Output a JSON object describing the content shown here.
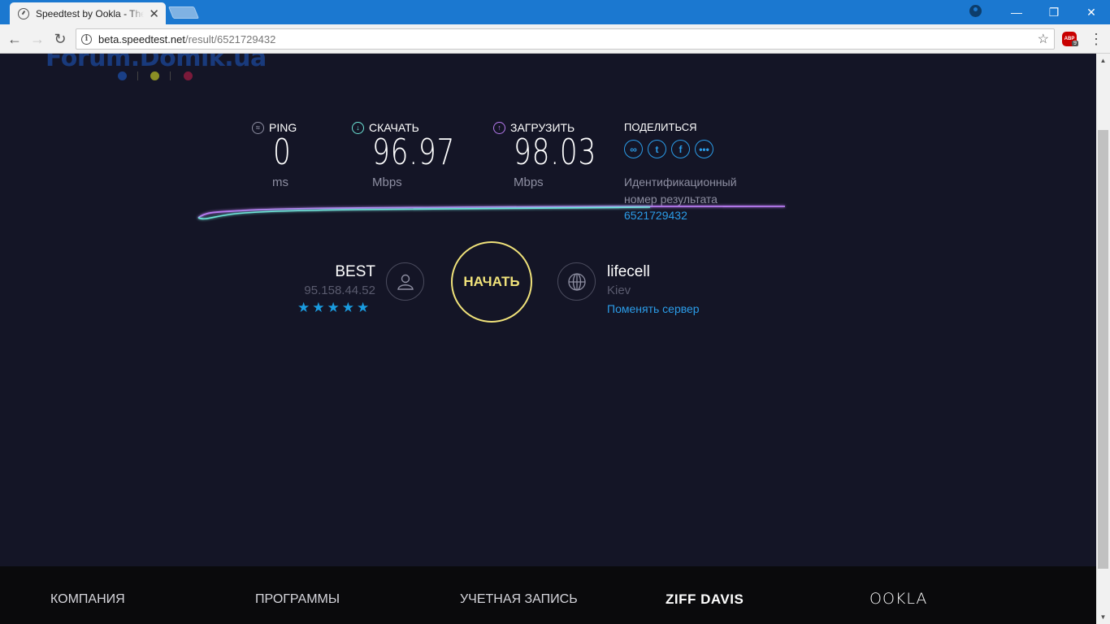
{
  "browser": {
    "tab_title": "Speedtest by Ookla - The",
    "url_host": "beta.speedtest.net",
    "url_path": "/result/6521729432",
    "abp_label": "ABP",
    "abp_count": "9"
  },
  "watermark": {
    "text": "Forum.Domik.ua"
  },
  "metrics": {
    "ping": {
      "label": "PING",
      "value": "0",
      "unit": "ms"
    },
    "download": {
      "label": "СКАЧАТЬ",
      "value": "96.97",
      "unit": "Mbps"
    },
    "upload": {
      "label": "ЗАГРУЗИТЬ",
      "value": "98.03",
      "unit": "Mbps"
    }
  },
  "share": {
    "title": "ПОДЕЛИТЬСЯ",
    "result_label": "Идентификационный номер результата",
    "result_id": "6521729432"
  },
  "isp": {
    "name": "BEST",
    "ip": "95.158.44.52",
    "rating": 5
  },
  "go_button": "НАЧАТЬ",
  "server": {
    "name": "lifecell",
    "city": "Kiev",
    "change_link": "Поменять сервер"
  },
  "footer": {
    "company": "КОМПАНИЯ",
    "apps": "ПРОГРАММЫ",
    "account": "УЧЕТНАЯ ЗАПИСЬ",
    "brand": "ZIFF DAVIS",
    "logo": "OOKLA"
  },
  "colors": {
    "page_bg": "#141526",
    "accent_blue": "#2b9ce8",
    "go_yellow": "#f0e27a",
    "download_cyan": "#6ee6d8",
    "upload_purple": "#b77af0"
  }
}
